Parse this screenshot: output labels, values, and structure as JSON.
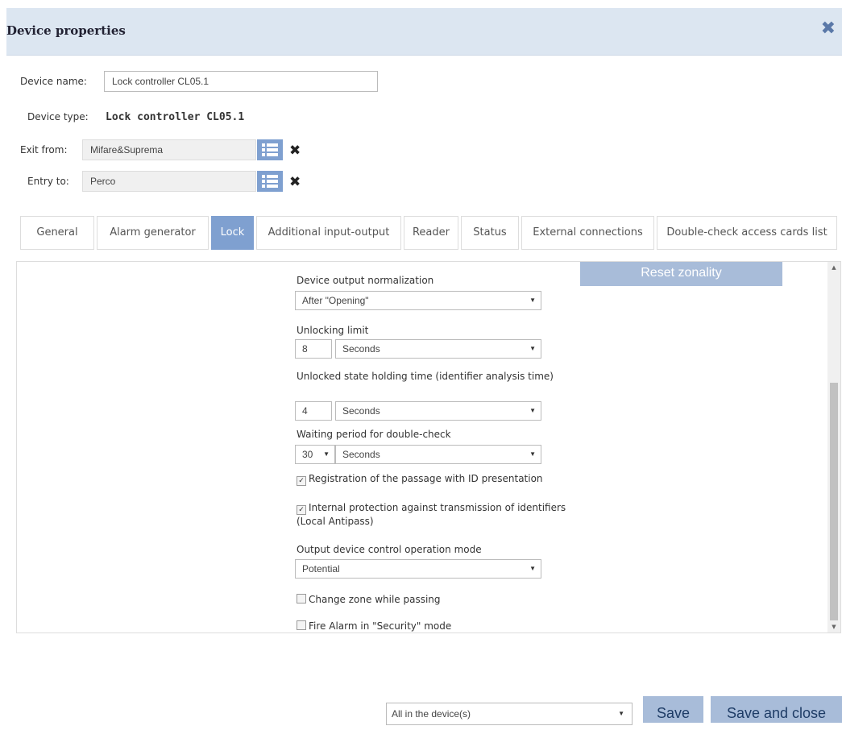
{
  "dialog": {
    "title": "Device properties"
  },
  "fields": {
    "device_name_label": "Device name:",
    "device_name_value": "Lock controller  CL05.1",
    "device_type_label": "Device type:",
    "device_type_value": "Lock controller CL05.1",
    "exit_from_label": "Exit from:",
    "exit_from_value": "Mifare&Suprema",
    "entry_to_label": "Entry to:",
    "entry_to_value": "Perco"
  },
  "tabs": [
    "General",
    "Alarm generator",
    "Lock",
    "Additional input-output",
    "Reader",
    "Status",
    "External connections",
    "Double-check access cards list"
  ],
  "active_tab": "Lock",
  "lock": {
    "reset_label": "Reset zonality",
    "output_normalization_label": "Device output normalization",
    "output_normalization_value": "After \"Opening\"",
    "unlocking_limit_label": "Unlocking limit",
    "unlocking_limit_value": "8",
    "unlocking_limit_unit": "Seconds",
    "holding_time_label": "Unlocked state holding time (identifier analysis time)",
    "holding_time_value": "4",
    "holding_time_unit": "Seconds",
    "waiting_period_label": "Waiting period for double-check",
    "waiting_period_value": "30",
    "waiting_period_unit": "Seconds",
    "registration_label": "Registration of the passage with ID presentation",
    "registration_checked": true,
    "antipass_label": "Internal protection against transmission of identifiers (Local Antipass)",
    "antipass_checked": true,
    "control_mode_label": "Output device control operation mode",
    "control_mode_value": "Potential",
    "change_zone_label": "Change zone while passing",
    "change_zone_checked": false,
    "fire_alarm_label": "Fire Alarm in \"Security\" mode",
    "fire_alarm_checked": false
  },
  "footer": {
    "apply_scope_value": "All in the device(s)",
    "save_label": "Save",
    "save_close_label": "Save and close"
  },
  "colors": {
    "header_bg": "#dce6f1",
    "accent": "#7fa0d0",
    "button_bg": "#a8bcd9"
  },
  "icons": {
    "close": "close-icon",
    "list": "list-icon",
    "clear": "clear-icon"
  }
}
